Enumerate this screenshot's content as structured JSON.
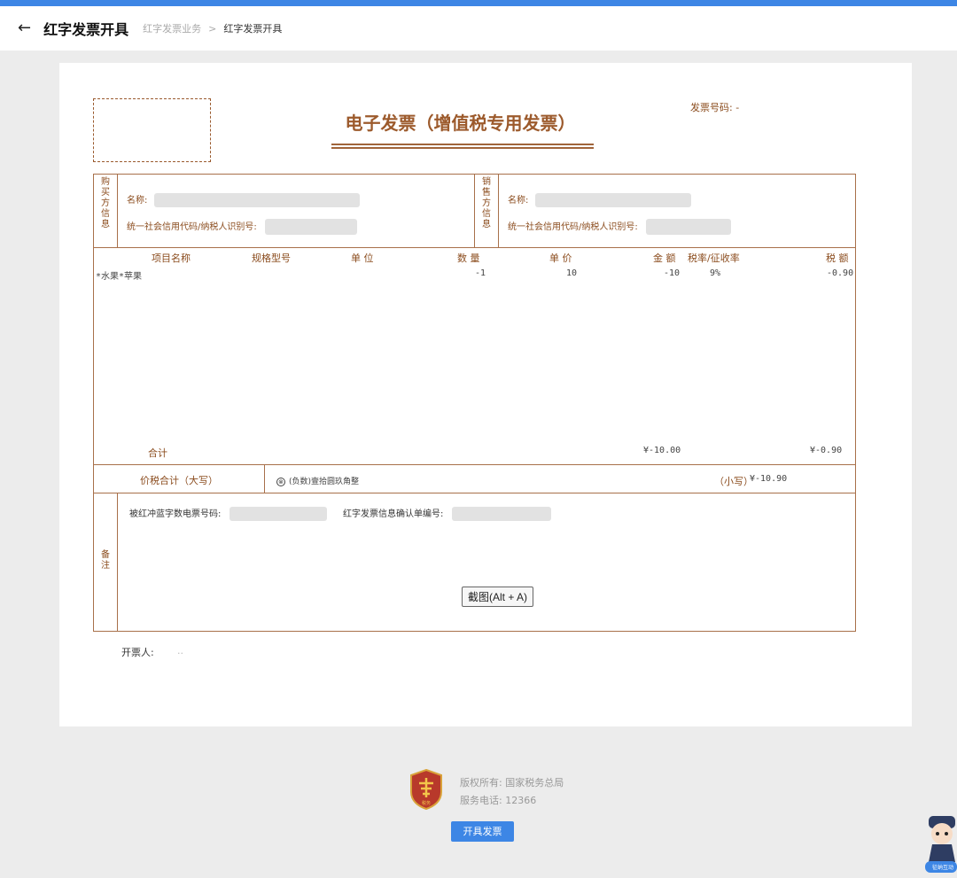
{
  "header": {
    "title": "红字发票开具",
    "breadcrumb": [
      "红字发票业务",
      "红字发票开具"
    ],
    "breadcrumb_sep": ">"
  },
  "invoice": {
    "title": "电子发票（增值税专用发票）",
    "number_label": "发票号码: -",
    "buyer": {
      "side_label": [
        "购",
        "买",
        "方",
        "信",
        "息"
      ],
      "name_label": "名称:",
      "tax_label": "统一社会信用代码/纳税人识别号:"
    },
    "seller": {
      "side_label": [
        "销",
        "售",
        "方",
        "信",
        "息"
      ],
      "name_label": "名称:",
      "tax_label": "统一社会信用代码/纳税人识别号:"
    },
    "columns": [
      "项目名称",
      "规格型号",
      "单 位",
      "数 量",
      "单 价",
      "金 额",
      "税率/征收率",
      "税 额"
    ],
    "items": [
      {
        "name": "*水果*苹果",
        "spec": "",
        "unit": "",
        "qty": "-1",
        "price": "10",
        "amount": "-10",
        "rate": "9%",
        "tax": "-0.90"
      }
    ],
    "total": {
      "label": "合计",
      "amount": "¥-10.00",
      "tax": "¥-0.90"
    },
    "sum": {
      "label": "价税合计（大写）",
      "upper_icon": "⊗",
      "upper": "(负数)壹拾圆玖角整",
      "lower_label": "（小写）",
      "lower": "¥-10.90"
    },
    "remark": {
      "side_label": [
        "备",
        "注"
      ],
      "blue_invoice_label": "被红冲蓝字数电票号码:",
      "confirm_label": "红字发票信息确认单编号:"
    },
    "issuer_label": "开票人:",
    "issuer_value": ".."
  },
  "screenshot_button": "截图(Alt + A)",
  "footer": {
    "copyright": "版权所有: 国家税务总局",
    "phone": "服务电话: 12366",
    "logo_text": "税务",
    "issue_button": "开具发票"
  },
  "assistant_label": "征纳互动",
  "colors": {
    "accent": "#3d86e5",
    "invoice": "#8b4c1e",
    "background": "#ececec"
  }
}
